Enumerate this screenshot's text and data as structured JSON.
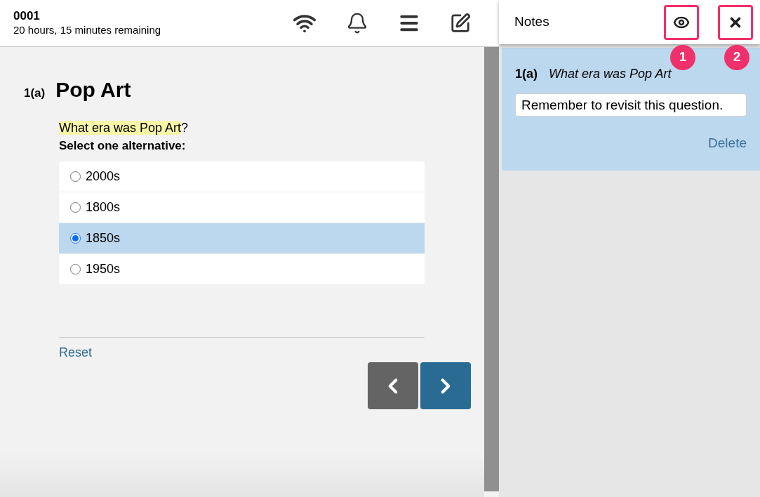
{
  "header": {
    "title": "0001",
    "subtitle": "20 hours, 15 minutes remaining"
  },
  "question": {
    "number": "1(a)",
    "title": "Pop Art",
    "prompt_highlight": "What era was Pop Art",
    "prompt_rest": "?",
    "instruction": "Select one alternative:",
    "options": [
      {
        "label": "2000s",
        "selected": false
      },
      {
        "label": "1800s",
        "selected": false
      },
      {
        "label": "1850s",
        "selected": true
      },
      {
        "label": "1950s",
        "selected": false
      }
    ],
    "reset": "Reset"
  },
  "notes": {
    "title": "Notes",
    "callouts": [
      "1",
      "2"
    ],
    "items": [
      {
        "number": "1(a)",
        "question": "What era was Pop Art",
        "text": "Remember to revisit this question.",
        "delete": "Delete"
      }
    ]
  }
}
